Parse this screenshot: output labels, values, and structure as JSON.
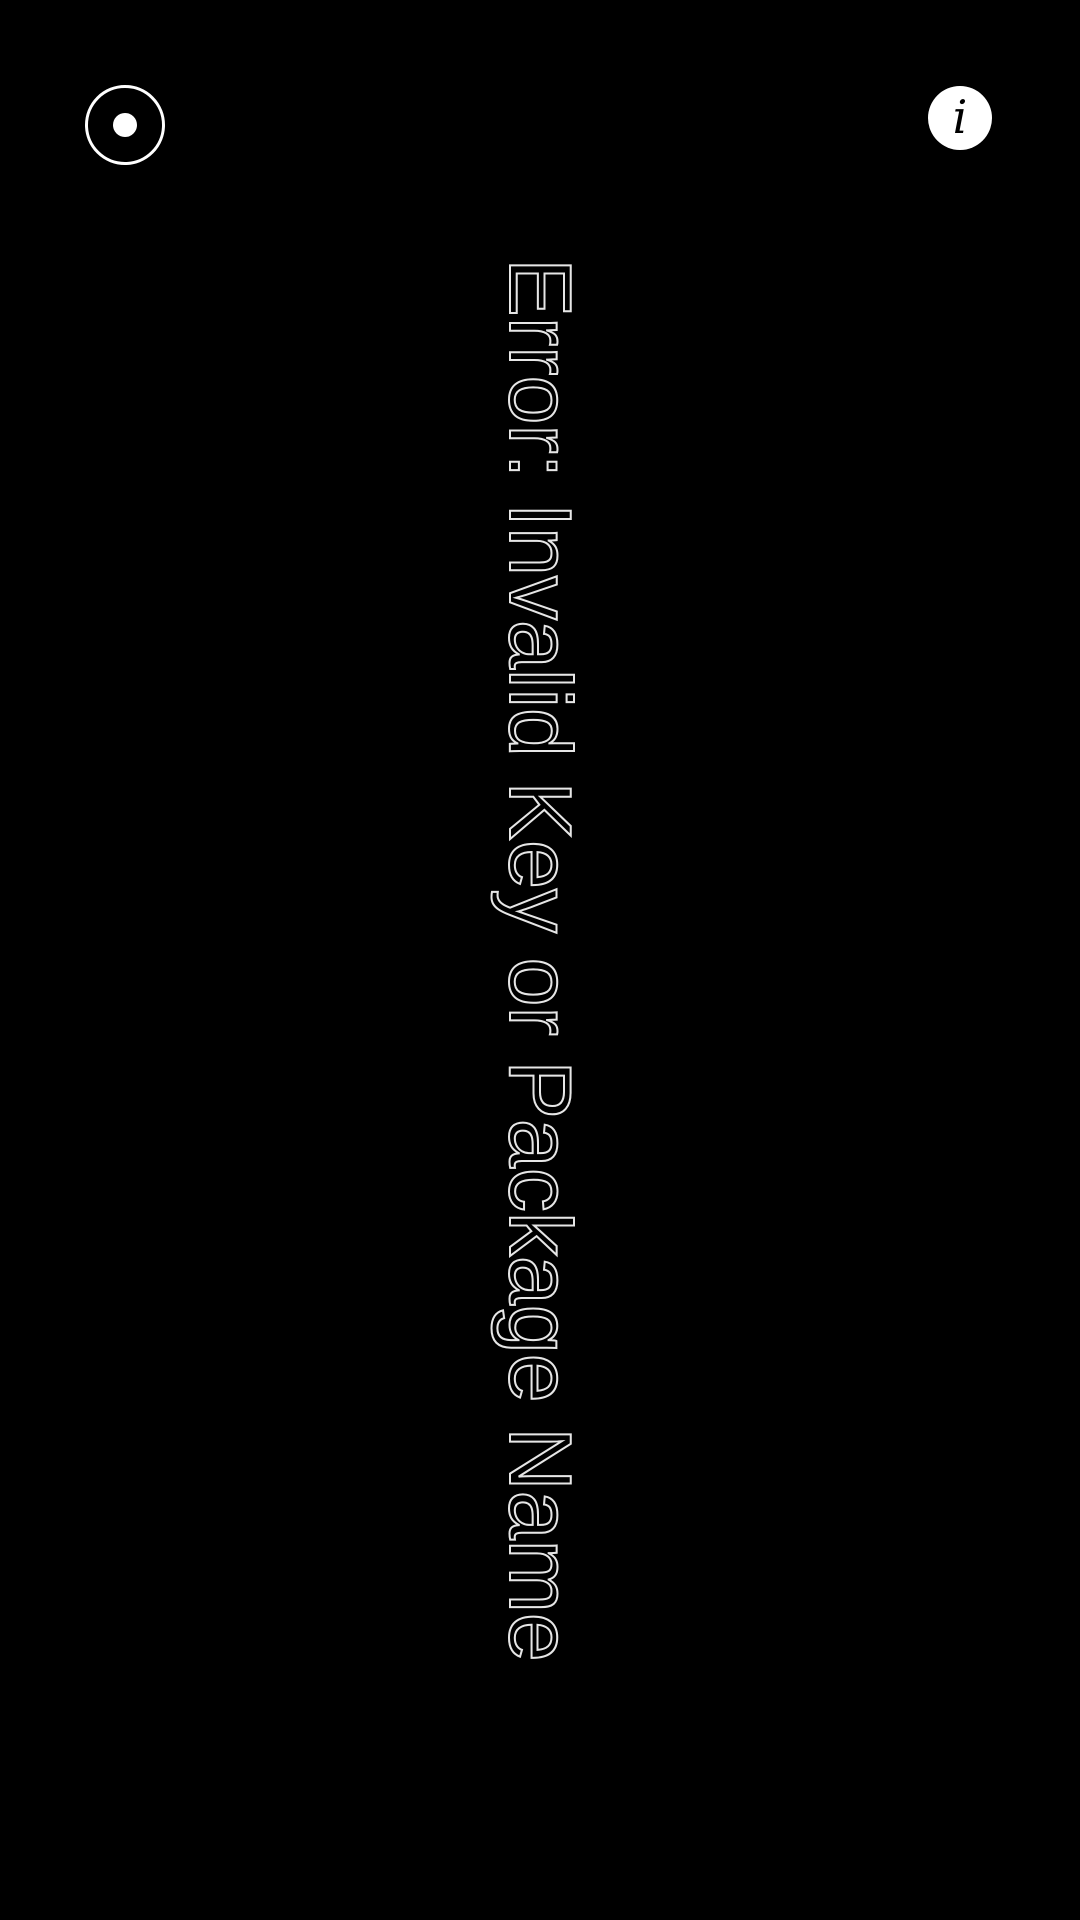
{
  "screen": {
    "background": "#000000"
  },
  "toolbar": {
    "target_icon": "target-icon",
    "info_icon": "info-icon",
    "info_glyph": "i",
    "icon_color": "#ffffff"
  },
  "message": {
    "error_text": "Error: Invalid Key or Package Name",
    "text_color": "#e6e6e6"
  }
}
